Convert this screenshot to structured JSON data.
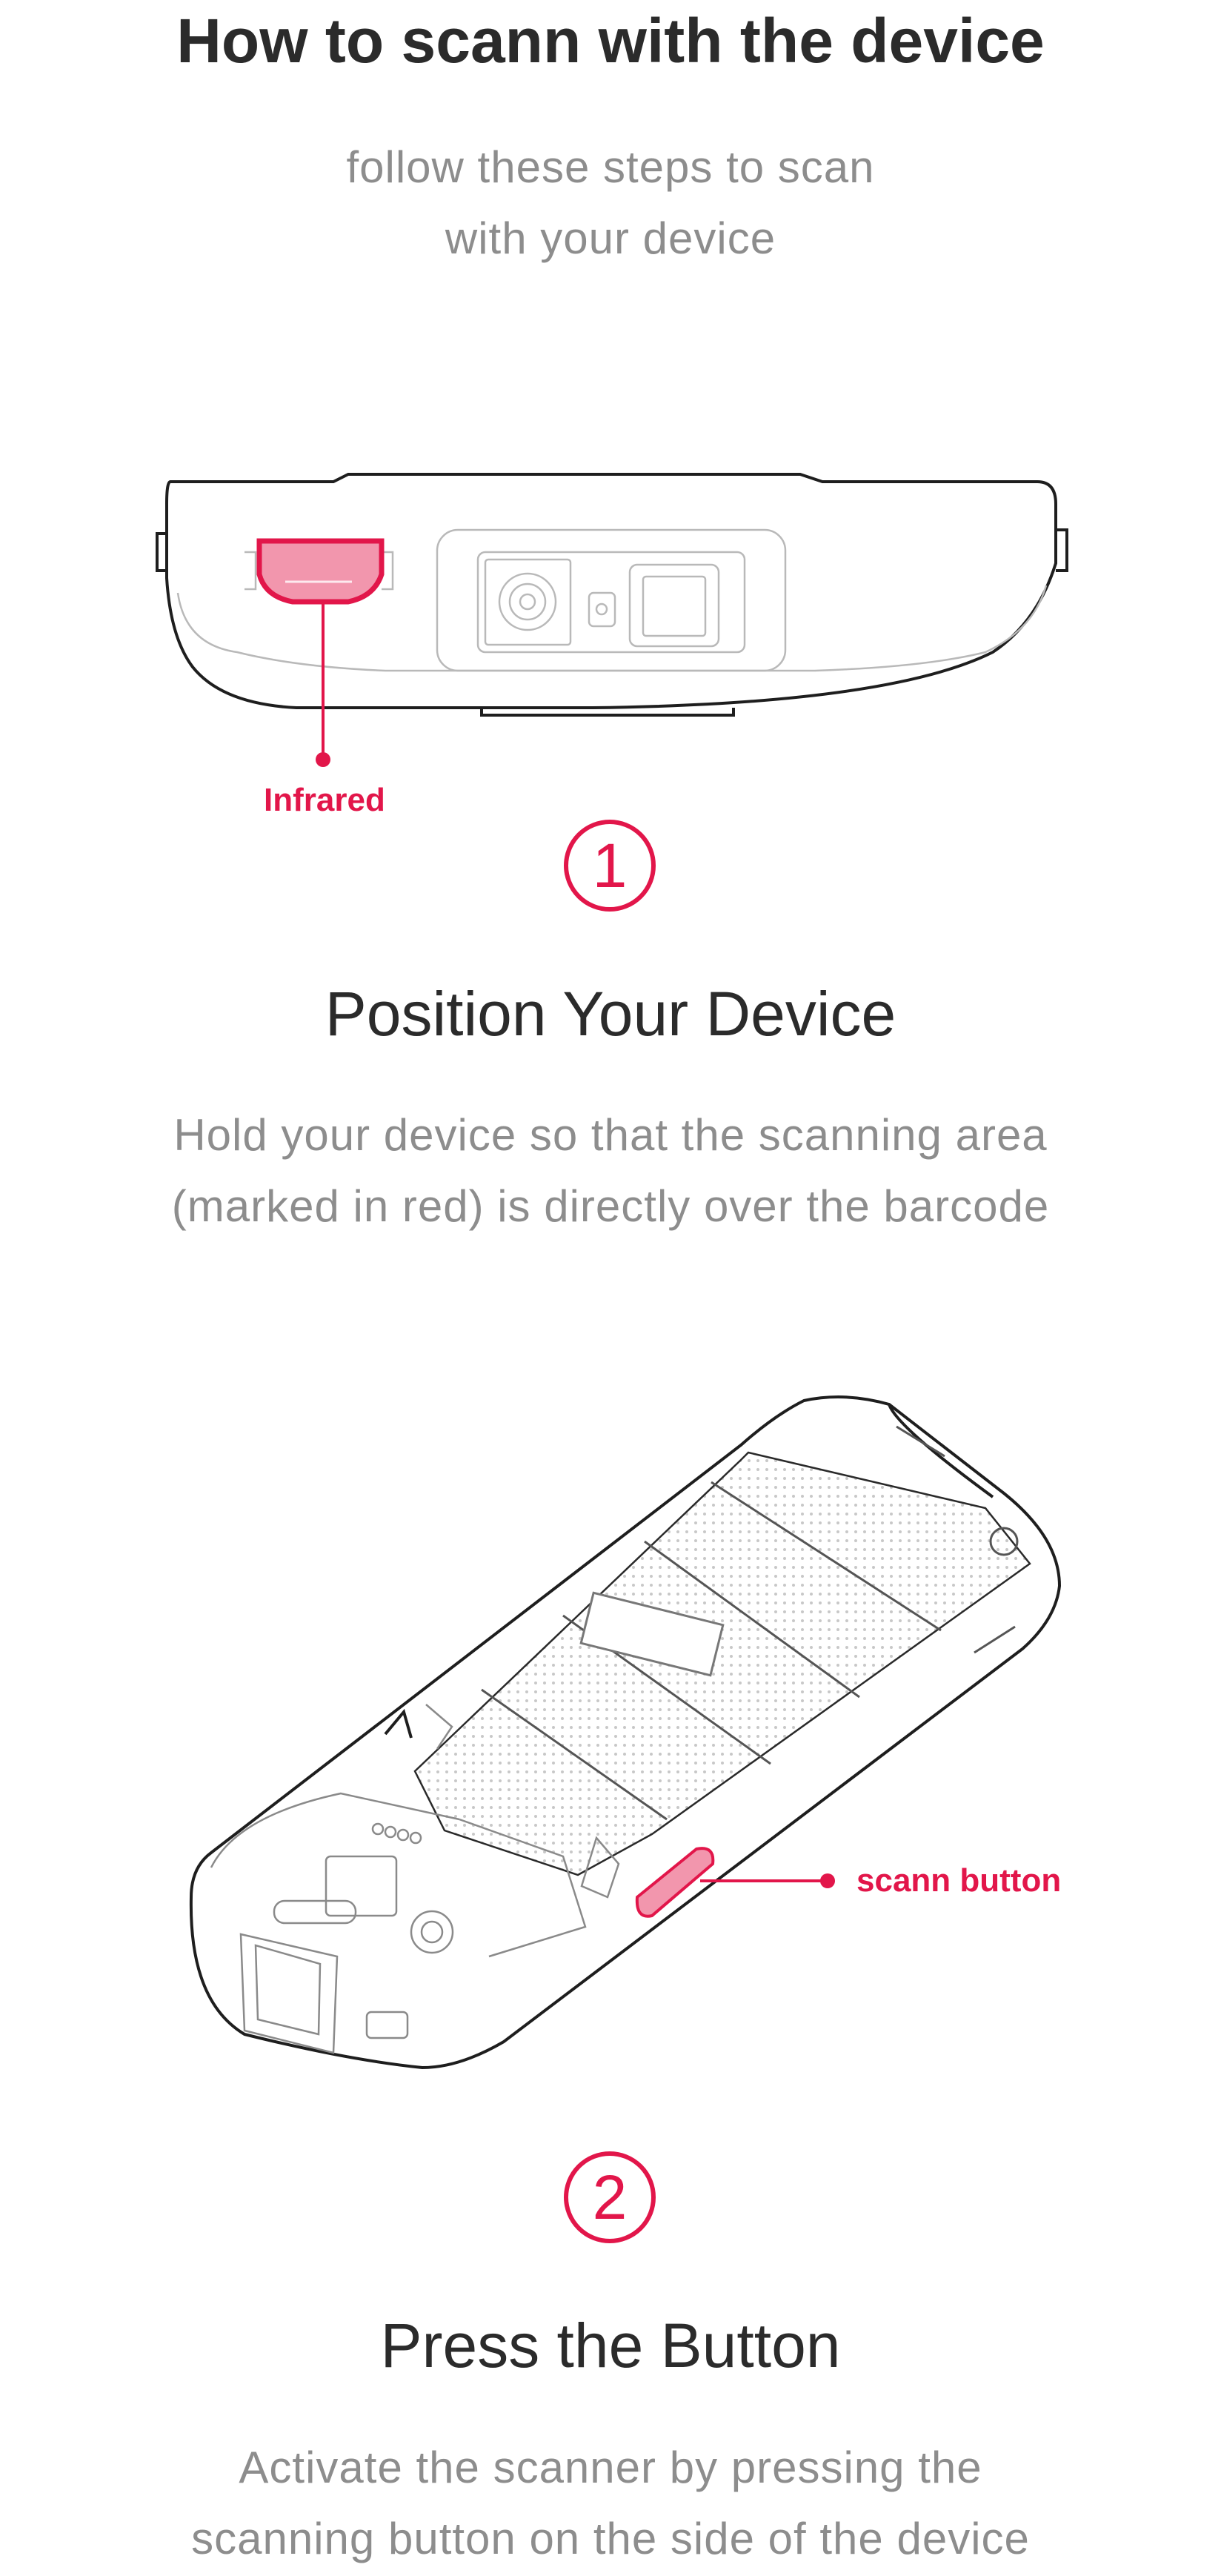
{
  "header": {
    "title": "How to scann with the device",
    "subtitle_line1": "follow these steps to scan",
    "subtitle_line2": "with your device"
  },
  "steps": [
    {
      "number": "1",
      "title": "Position Your Device",
      "desc_line1": "Hold your device so that the scanning area",
      "desc_line2": "(marked in red) is directly over the barcode",
      "callout": "Infrared"
    },
    {
      "number": "2",
      "title": "Press the Button",
      "desc_line1": "Activate the scanner by pressing the",
      "desc_line2": "scanning button on the side of the device",
      "callout": "scann button"
    }
  ],
  "colors": {
    "accent": "#e2164a",
    "heading": "#2b2b2b",
    "muted": "#8d8d8d"
  }
}
